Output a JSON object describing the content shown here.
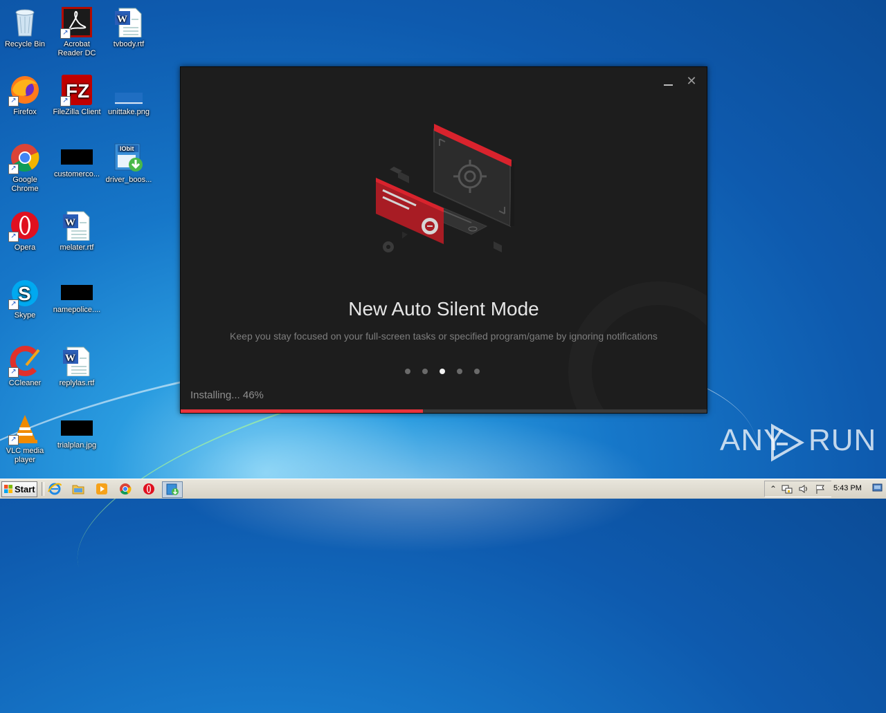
{
  "desktop": {
    "icons": [
      {
        "label": "Recycle Bin",
        "icon": "recycle-bin-icon"
      },
      {
        "label": "Acrobat Reader DC",
        "icon": "acrobat-reader-icon"
      },
      {
        "label": "tvbody.rtf",
        "icon": "word-document-icon"
      },
      {
        "label": "Firefox",
        "icon": "firefox-icon"
      },
      {
        "label": "FileZilla Client",
        "icon": "filezilla-icon"
      },
      {
        "label": "unittake.png",
        "icon": "image-file-icon"
      },
      {
        "label": "Google Chrome",
        "icon": "chrome-icon"
      },
      {
        "label": "customerco...",
        "icon": "black-thumbnail-icon"
      },
      {
        "label": "driver_boos...",
        "icon": "iobit-installer-icon"
      },
      {
        "label": "Opera",
        "icon": "opera-icon"
      },
      {
        "label": "melater.rtf",
        "icon": "word-document-icon"
      },
      {
        "label": "Skype",
        "icon": "skype-icon"
      },
      {
        "label": "namepolice....",
        "icon": "black-thumbnail-icon"
      },
      {
        "label": "CCleaner",
        "icon": "ccleaner-icon"
      },
      {
        "label": "replylas.rtf",
        "icon": "word-document-icon"
      },
      {
        "label": "VLC media player",
        "icon": "vlc-icon"
      },
      {
        "label": "trialplan.jpg",
        "icon": "black-thumbnail-icon"
      }
    ]
  },
  "installer": {
    "slide_title": "New Auto Silent Mode",
    "slide_subtitle": "Keep you stay focused on your full-screen tasks or specified program/game by ignoring notifications",
    "slide_count": 5,
    "active_slide": 3,
    "status_text": "Installing... 46%",
    "progress": 0.46,
    "accent_color": "#e8333c",
    "background_color": "#1d1d1d"
  },
  "watermark": {
    "left": "ANY",
    "right": "RUN"
  },
  "taskbar": {
    "start_label": "Start",
    "apps": [
      "internet-explorer-icon",
      "file-explorer-icon",
      "media-player-icon",
      "chrome-icon",
      "opera-icon",
      "installer-icon"
    ],
    "clock": "5:43 PM"
  }
}
